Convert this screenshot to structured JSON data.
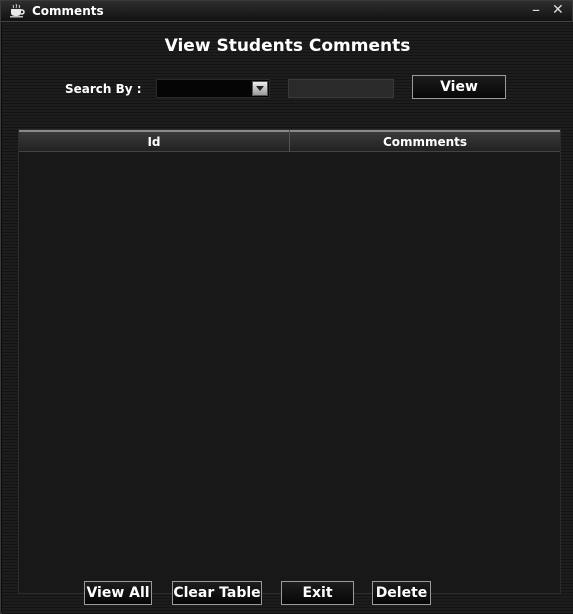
{
  "window": {
    "title": "Comments",
    "minimize": "–",
    "close": "✕"
  },
  "heading": "View Students Comments",
  "search": {
    "label": "Search By :",
    "selected": "",
    "value": "",
    "view_label": "View"
  },
  "table": {
    "columns": [
      "Id",
      "Commments"
    ],
    "rows": []
  },
  "buttons": {
    "view_all": "View All",
    "clear_table": "Clear Table",
    "exit": "Exit",
    "delete": "Delete"
  },
  "icons": {
    "app": "coffee-cup-icon",
    "combo_arrow": "chevron-down-icon"
  },
  "colors": {
    "background": "#1a1a1a",
    "text": "#ffffff",
    "button_border": "#9a9a9a"
  }
}
